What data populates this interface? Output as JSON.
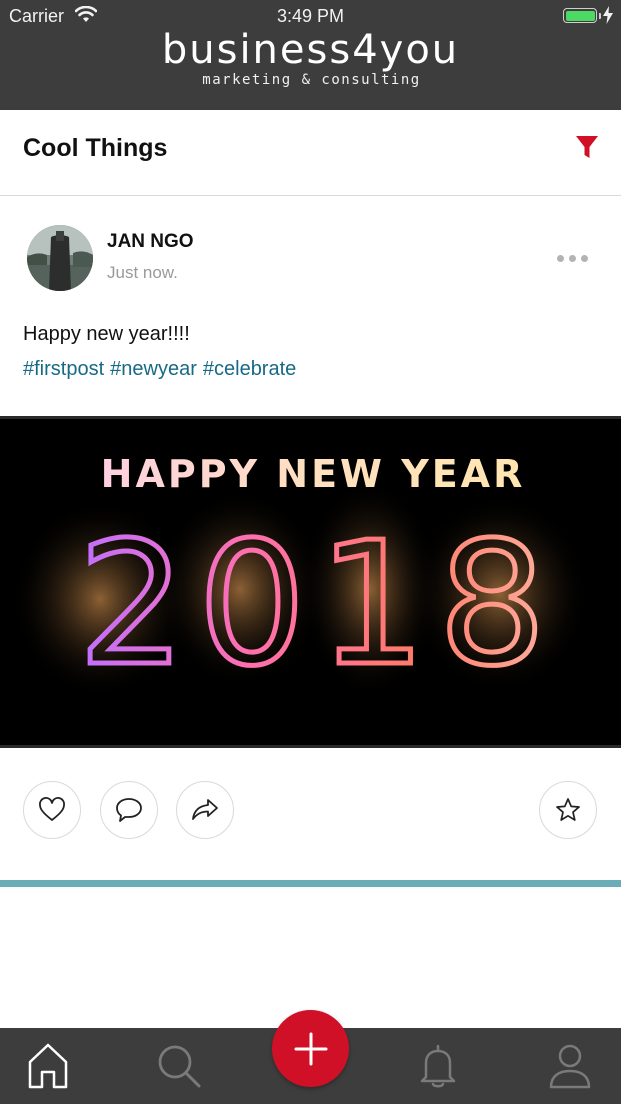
{
  "status_bar": {
    "carrier": "Carrier",
    "time": "3:49 PM",
    "battery_color": "#4cd964"
  },
  "brand": {
    "name": "business4you",
    "tagline": "marketing & consulting"
  },
  "section": {
    "title": "Cool Things",
    "filter_icon": "filter-icon",
    "accent_color": "#d01027"
  },
  "post": {
    "author": "JAN NGO",
    "time": "Just now.",
    "text": "Happy new year!!!!",
    "hashtags": [
      "#firstpost",
      "#newyear",
      "#celebrate"
    ],
    "image_text": {
      "line1": "HAPPY NEW YEAR",
      "line2": "2018"
    },
    "actions": [
      "heart-icon",
      "comment-icon",
      "share-icon",
      "star-icon"
    ]
  },
  "tabbar": {
    "tabs": [
      "home-icon",
      "search-icon",
      "add-icon",
      "bell-icon",
      "user-icon"
    ],
    "fab_color": "#d01027",
    "background": "#3d3d3d"
  },
  "divider_color": "#6aadb6"
}
